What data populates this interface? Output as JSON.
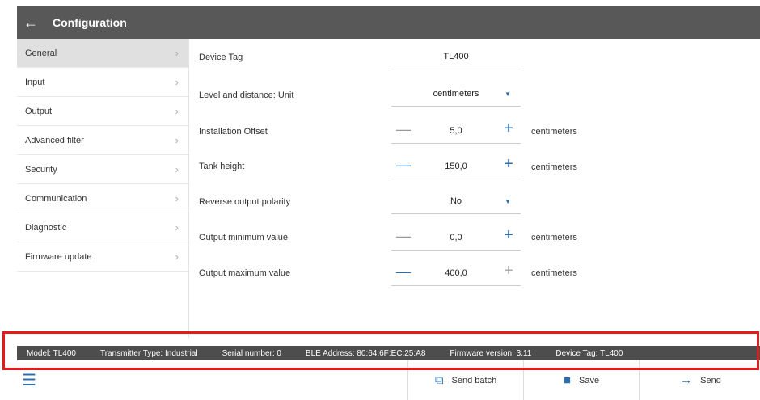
{
  "header": {
    "back_icon": "arrow-left-icon",
    "title": "Configuration"
  },
  "sidebar": {
    "items": [
      {
        "label": "General",
        "active": true
      },
      {
        "label": "Input"
      },
      {
        "label": "Output"
      },
      {
        "label": "Advanced filter"
      },
      {
        "label": "Security"
      },
      {
        "label": "Communication"
      },
      {
        "label": "Diagnostic"
      },
      {
        "label": "Firmware update"
      }
    ],
    "chevron": "›"
  },
  "fields": {
    "device_tag": {
      "label": "Device Tag",
      "value": "TL400"
    },
    "unit": {
      "label": "Level and distance: Unit",
      "value": "centimeters"
    },
    "offset": {
      "label": "Installation Offset",
      "value": "5,0",
      "unit": "centimeters"
    },
    "tank_height": {
      "label": "Tank height",
      "value": "150,0",
      "unit": "centimeters"
    },
    "polarity": {
      "label": "Reverse output polarity",
      "value": "No"
    },
    "out_min": {
      "label": "Output minimum value",
      "value": "0,0",
      "unit": "centimeters"
    },
    "out_max": {
      "label": "Output maximum value",
      "value": "400,0",
      "unit": "centimeters"
    }
  },
  "status": {
    "model": "Model: TL400",
    "transmitter": "Transmitter Type: Industrial",
    "serial": "Serial number: 0",
    "ble": "BLE Address: 80:64:6F:EC:25:A8",
    "firmware": "Firmware version: 3.11",
    "tag": "Device Tag: TL400"
  },
  "footer": {
    "send_batch": "Send batch",
    "save": "Save",
    "send": "Send"
  },
  "colors": {
    "header": "#585858",
    "accent": "#2a6fb5",
    "highlight": "#e41b1b"
  }
}
